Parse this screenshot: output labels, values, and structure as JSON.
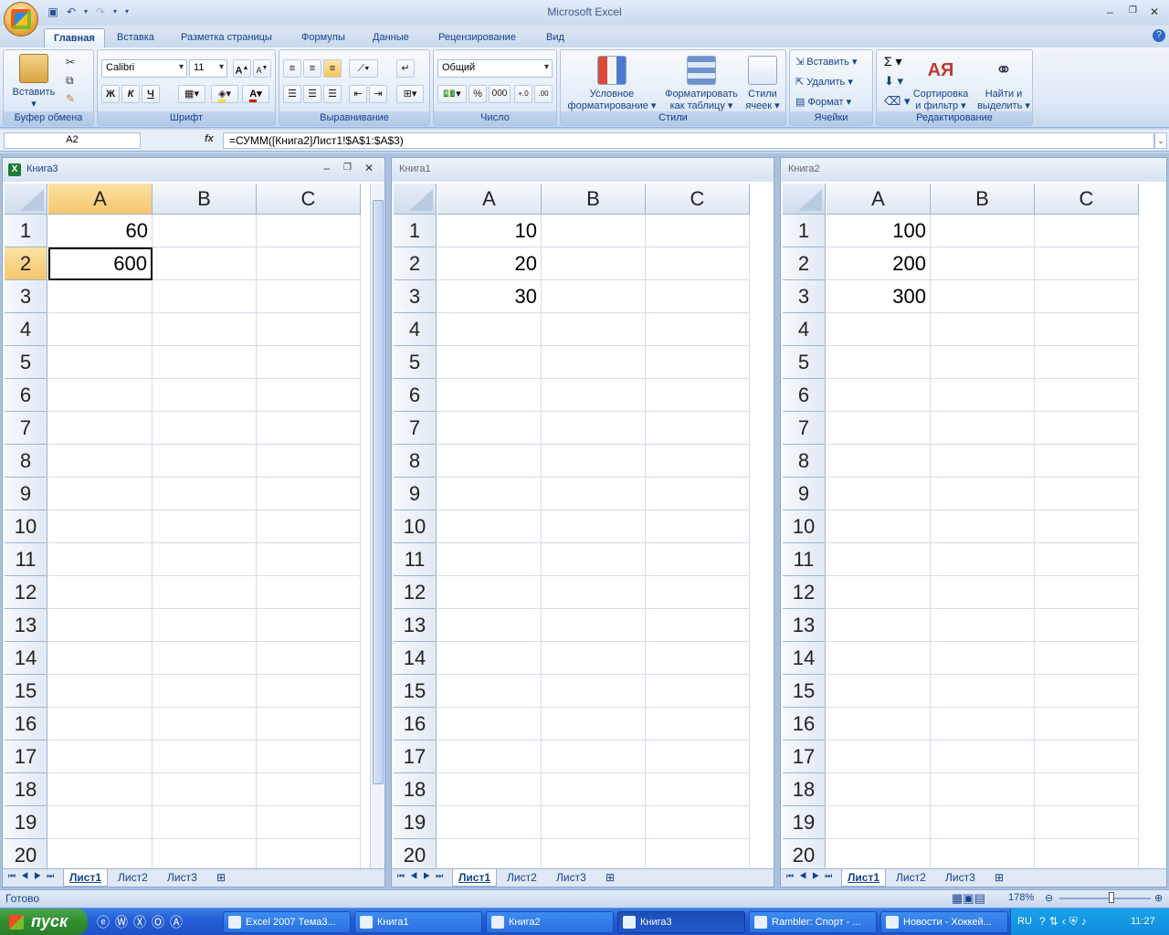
{
  "app": {
    "title": "Microsoft Excel"
  },
  "ribbon": {
    "tabs": [
      "Главная",
      "Вставка",
      "Разметка страницы",
      "Формулы",
      "Данные",
      "Рецензирование",
      "Вид"
    ],
    "clipboard": {
      "paste": "Вставить",
      "label": "Буфер обмена"
    },
    "font": {
      "name": "Calibri",
      "size": "11",
      "bold": "Ж",
      "italic": "К",
      "underline": "Ч",
      "label": "Шрифт"
    },
    "alignment": {
      "label": "Выравнивание"
    },
    "number": {
      "format": "Общий",
      "percent": "%",
      "thousands": "000",
      "label": "Число"
    },
    "styles": {
      "conditional_line1": "Условное",
      "conditional_line2": "форматирование",
      "as_table_line1": "Форматировать",
      "as_table_line2": "как таблицу",
      "cell_styles_line1": "Стили",
      "cell_styles_line2": "ячеек",
      "label": "Стили"
    },
    "cells": {
      "insert": "Вставить",
      "delete": "Удалить",
      "format": "Формат",
      "label": "Ячейки"
    },
    "editing": {
      "sort_line1": "Сортировка",
      "sort_line2": "и фильтр",
      "find_line1": "Найти и",
      "find_line2": "выделить",
      "label": "Редактирование"
    }
  },
  "formula_bar": {
    "name_box": "A2",
    "fx": "fx",
    "formula": "=СУММ([Книга2]Лист1!$A$1:$A$3)"
  },
  "columns": [
    "A",
    "B",
    "C"
  ],
  "rows": [
    "1",
    "2",
    "3",
    "4",
    "5",
    "6",
    "7",
    "8",
    "9",
    "10",
    "11",
    "12",
    "13",
    "14",
    "15",
    "16",
    "17",
    "18",
    "19",
    "20"
  ],
  "workbooks": [
    {
      "title": "Книга3",
      "values": [
        "60",
        "600"
      ],
      "sheets": [
        "Лист1",
        "Лист2",
        "Лист3"
      ]
    },
    {
      "title": "Книга1",
      "values": [
        "10",
        "20",
        "30"
      ],
      "sheets": [
        "Лист1",
        "Лист2",
        "Лист3"
      ]
    },
    {
      "title": "Книга2",
      "values": [
        "100",
        "200",
        "300"
      ],
      "sheets": [
        "Лист1",
        "Лист2",
        "Лист3"
      ]
    }
  ],
  "status": {
    "text": "Готово",
    "zoom": "178%"
  },
  "taskbar": {
    "start": "пуск",
    "items": [
      "Excel 2007 Тема3...",
      "Книга1",
      "Книга2",
      "Книга3",
      "Rambler: Спорт - ...",
      "Новости - Хоккей..."
    ],
    "lang": "RU",
    "clock": "11:27"
  }
}
